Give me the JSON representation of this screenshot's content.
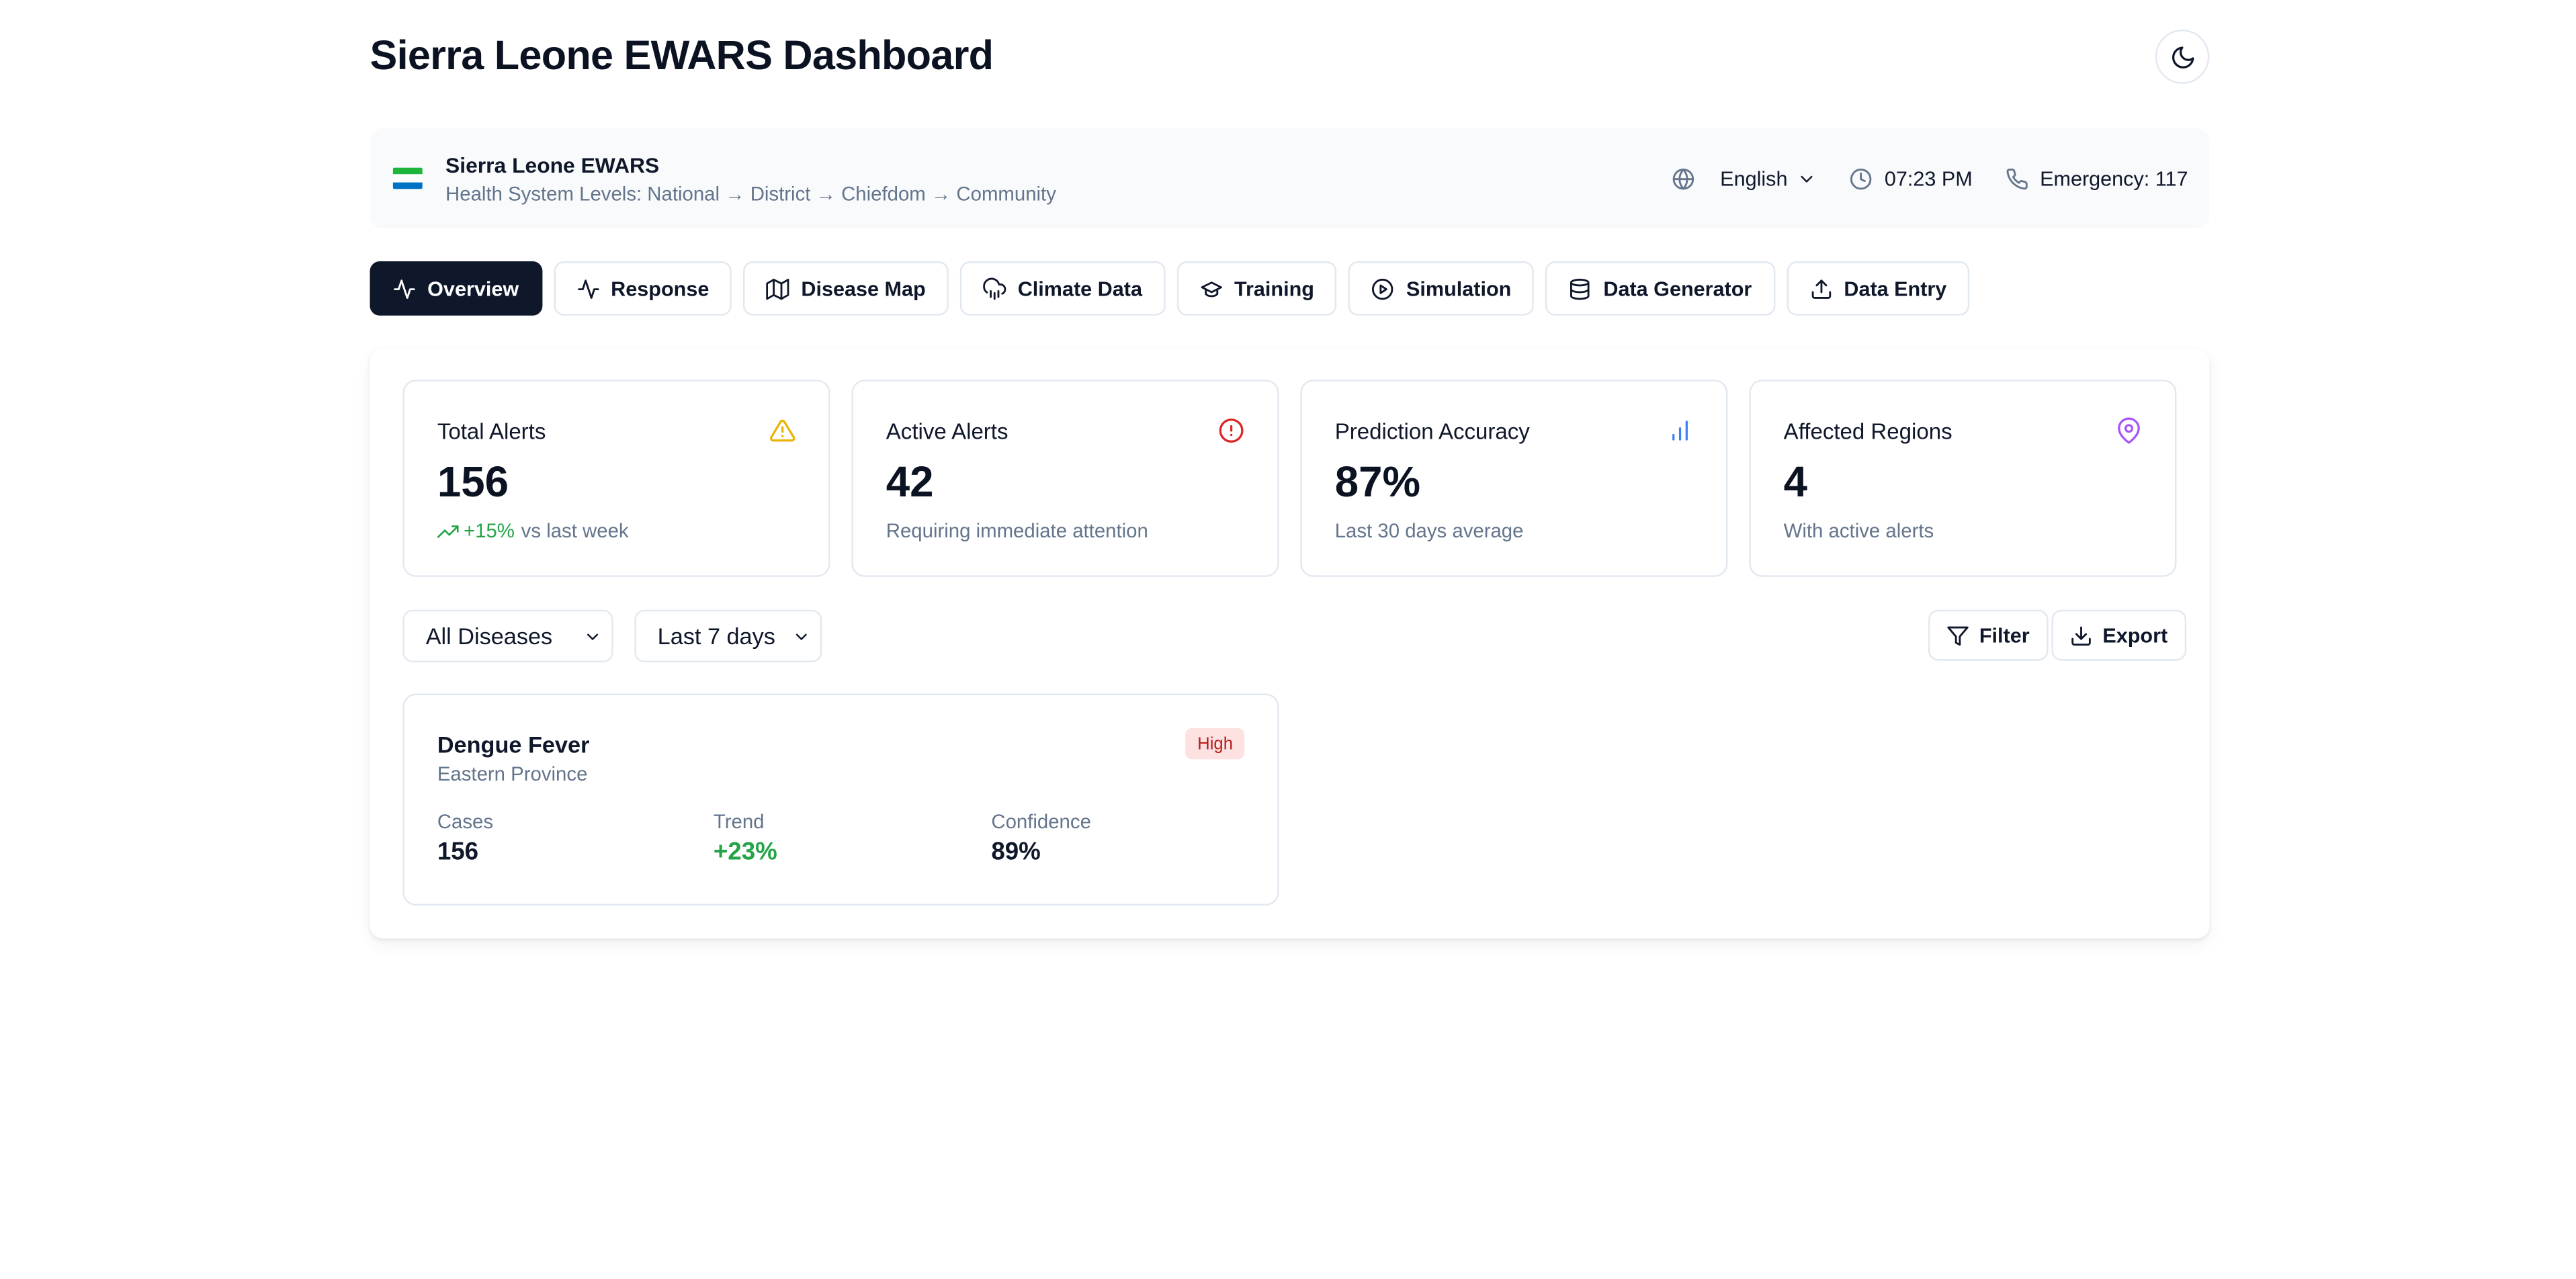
{
  "header": {
    "title": "Sierra Leone EWARS Dashboard",
    "theme_toggle_icon": "moon-icon"
  },
  "info_bar": {
    "org_name": "Sierra Leone EWARS",
    "levels": "Health System Levels: National → District → Chiefdom → Community",
    "flag_colors": [
      "#1eb53a",
      "#ffffff",
      "#0072c6"
    ],
    "language": "English",
    "time": "07:23 PM",
    "emergency": "Emergency: 117"
  },
  "tabs": [
    {
      "label": "Overview",
      "icon": "activity-icon",
      "active": true
    },
    {
      "label": "Response",
      "icon": "activity-icon",
      "active": false
    },
    {
      "label": "Disease Map",
      "icon": "map-icon",
      "active": false
    },
    {
      "label": "Climate Data",
      "icon": "cloud-rain-icon",
      "active": false
    },
    {
      "label": "Training",
      "icon": "graduation-cap-icon",
      "active": false
    },
    {
      "label": "Simulation",
      "icon": "play-circle-icon",
      "active": false
    },
    {
      "label": "Data Generator",
      "icon": "database-icon",
      "active": false
    },
    {
      "label": "Data Entry",
      "icon": "upload-icon",
      "active": false
    }
  ],
  "stats": [
    {
      "label": "Total Alerts",
      "value": "156",
      "trend": "+15%",
      "sub": "vs last week",
      "icon": "warning-triangle-icon",
      "color": "#eab308"
    },
    {
      "label": "Active Alerts",
      "value": "42",
      "sub": "Requiring immediate attention",
      "icon": "alert-circle-icon",
      "color": "#dc2626"
    },
    {
      "label": "Prediction Accuracy",
      "value": "87%",
      "sub": "Last 30 days average",
      "icon": "bar-chart-icon",
      "color": "#3b82f6"
    },
    {
      "label": "Affected Regions",
      "value": "4",
      "sub": "With active alerts",
      "icon": "map-pin-icon",
      "color": "#a855f7"
    }
  ],
  "filters": {
    "disease": "All Diseases",
    "period": "Last 7 days",
    "filter_label": "Filter",
    "export_label": "Export"
  },
  "alerts": [
    {
      "disease": "Dengue Fever",
      "region": "Eastern Province",
      "severity": "High",
      "cases_label": "Cases",
      "cases": "156",
      "trend_label": "Trend",
      "trend": "+23%",
      "confidence_label": "Confidence",
      "confidence": "89%"
    }
  ]
}
